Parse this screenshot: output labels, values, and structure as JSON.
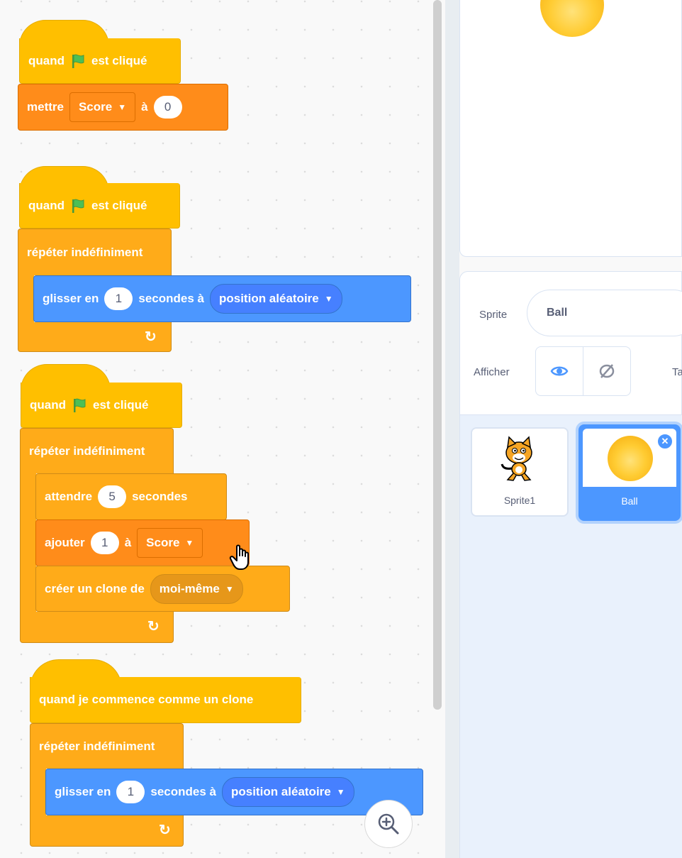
{
  "scripts": [
    {
      "hat": {
        "before": "quand",
        "after": "est cliqué"
      },
      "set_block": {
        "label": "mettre",
        "variable": "Score",
        "to": "à",
        "value": "0"
      }
    },
    {
      "hat": {
        "before": "quand",
        "after": "est cliqué"
      },
      "loop": "répéter indéfiniment",
      "glide": {
        "label": "glisser en",
        "value": "1",
        "unit": "secondes à",
        "target": "position aléatoire"
      }
    },
    {
      "hat": {
        "before": "quand",
        "after": "est cliqué"
      },
      "loop": "répéter indéfiniment",
      "wait": {
        "label": "attendre",
        "value": "5",
        "unit": "secondes"
      },
      "change": {
        "label": "ajouter",
        "value": "1",
        "to": "à",
        "variable": "Score"
      },
      "clone": {
        "label": "créer un clone de",
        "target": "moi-même"
      }
    },
    {
      "hat": {
        "label": "quand je commence comme un clone"
      },
      "loop": "répéter indéfiniment",
      "glide": {
        "label": "glisser en",
        "value": "1",
        "unit": "secondes à",
        "target": "position aléatoire"
      }
    }
  ],
  "sprite_info": {
    "sprite_label": "Sprite",
    "sprite_name": "Ball",
    "show_label": "Afficher",
    "truncated_label": "Ta"
  },
  "sprite_list": [
    {
      "name": "Sprite1",
      "selected": false
    },
    {
      "name": "Ball",
      "selected": true
    }
  ],
  "icons": {
    "green_flag": "green-flag-icon",
    "loop_arrow": "loop-arrow-icon",
    "eye": "eye-icon",
    "eye_hidden": "eye-slash-icon",
    "zoom_in": "zoom-in-icon",
    "delete": "delete-x-icon",
    "cursor": "hand-cursor-icon"
  },
  "colors": {
    "events": "#ffbf00",
    "control": "#ffab19",
    "variables": "#ff8c1a",
    "motion": "#4c97ff",
    "selection": "#4c97ff"
  }
}
